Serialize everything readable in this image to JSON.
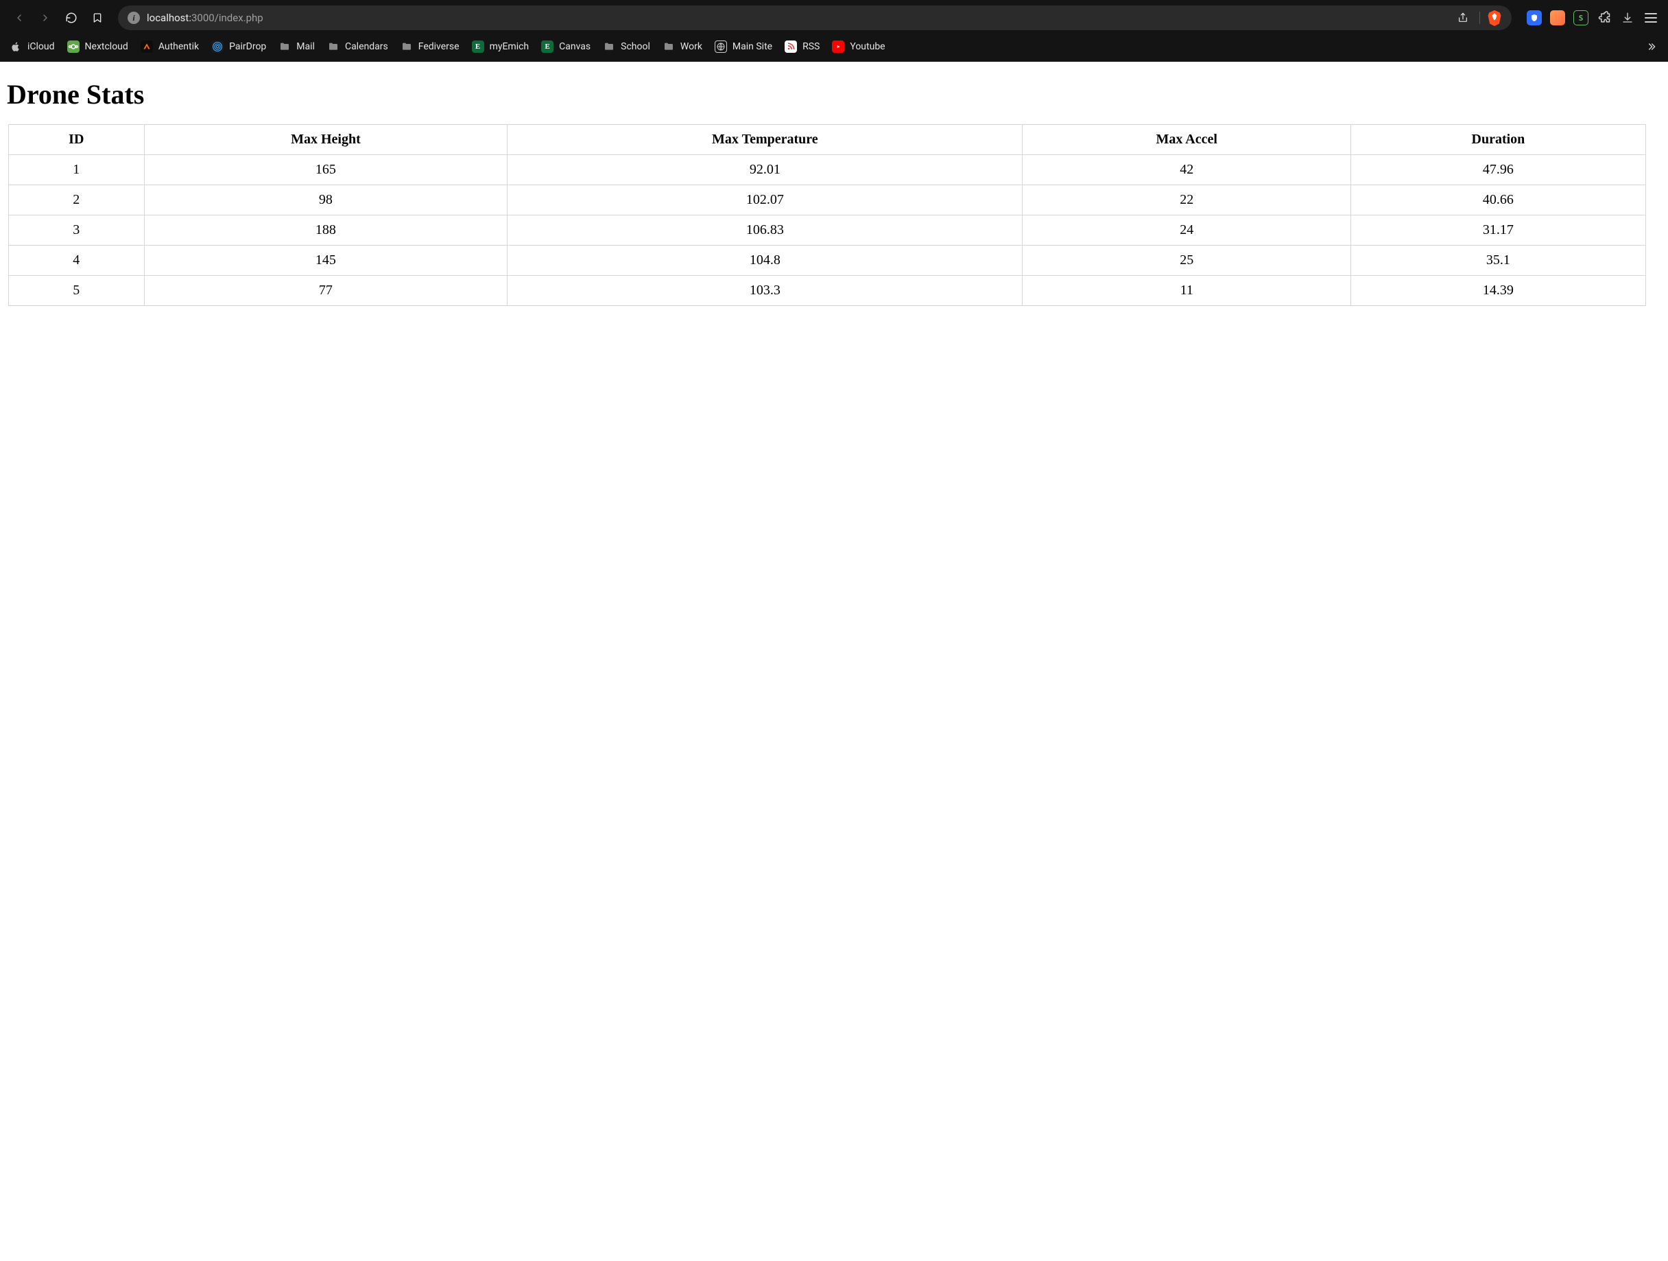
{
  "browser": {
    "url_host": "localhost:",
    "url_port_path": "3000/index.php",
    "bookmarks": [
      {
        "label": "iCloud",
        "icon": "apple"
      },
      {
        "label": "Nextcloud",
        "icon": "nextcloud"
      },
      {
        "label": "Authentik",
        "icon": "authentik"
      },
      {
        "label": "PairDrop",
        "icon": "pairdrop"
      },
      {
        "label": "Mail",
        "icon": "folder"
      },
      {
        "label": "Calendars",
        "icon": "folder"
      },
      {
        "label": "Fediverse",
        "icon": "folder"
      },
      {
        "label": "myEmich",
        "icon": "emich"
      },
      {
        "label": "Canvas",
        "icon": "canvas"
      },
      {
        "label": "School",
        "icon": "folder"
      },
      {
        "label": "Work",
        "icon": "folder"
      },
      {
        "label": "Main Site",
        "icon": "mainsite"
      },
      {
        "label": "RSS",
        "icon": "rss"
      },
      {
        "label": "Youtube",
        "icon": "youtube"
      }
    ]
  },
  "page": {
    "title": "Drone Stats",
    "columns": [
      "ID",
      "Max Height",
      "Max Temperature",
      "Max Accel",
      "Duration"
    ],
    "rows": [
      {
        "id": "1",
        "max_height": "165",
        "max_temp": "92.01",
        "max_accel": "42",
        "duration": "47.96"
      },
      {
        "id": "2",
        "max_height": "98",
        "max_temp": "102.07",
        "max_accel": "22",
        "duration": "40.66"
      },
      {
        "id": "3",
        "max_height": "188",
        "max_temp": "106.83",
        "max_accel": "24",
        "duration": "31.17"
      },
      {
        "id": "4",
        "max_height": "145",
        "max_temp": "104.8",
        "max_accel": "25",
        "duration": "35.1"
      },
      {
        "id": "5",
        "max_height": "77",
        "max_temp": "103.3",
        "max_accel": "11",
        "duration": "14.39"
      }
    ]
  }
}
